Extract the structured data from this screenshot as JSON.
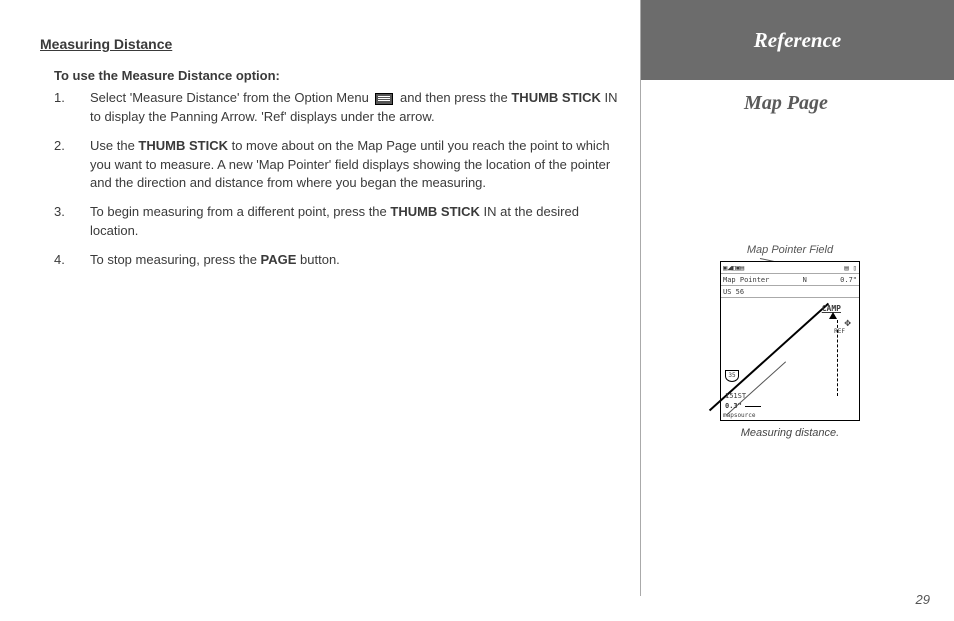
{
  "section_title": "Measuring Distance",
  "sub_title": "To use the Measure Distance option:",
  "steps": [
    {
      "num": "1.",
      "before": "Select 'Measure Distance' from the Option Menu ",
      "bold": "THUMB STICK",
      "mid": " and then press the ",
      "after": " IN to display the Panning Arrow.  'Ref' displays under the arrow."
    },
    {
      "num": "2.",
      "before": "Use the ",
      "bold": "THUMB STICK",
      "after": " to move about on the Map Page until you reach the point to which you want to measure.  A new 'Map Pointer' field displays showing the location of the pointer and the direction and distance from where you began the measuring."
    },
    {
      "num": "3.",
      "before": "To begin measuring from a different point, press the ",
      "bold": "THUMB STICK",
      "after": " IN at the desired location."
    },
    {
      "num": "4.",
      "before": "To stop measuring, press the ",
      "bold": "PAGE",
      "after": " button."
    }
  ],
  "ref_header": "Reference",
  "map_title": "Map Page",
  "fig_label": "Map Pointer Field",
  "screen": {
    "top_left": "▣◢◧▣▤",
    "top_right": "▤ ▯",
    "mp_label": "Map Pointer",
    "mp_n": "N",
    "mp_dist": "0.7\"",
    "us": "US 56",
    "camp": "CAMP",
    "ref": "REF",
    "shield": "35",
    "street": "151ST",
    "scale": "0.3\"",
    "mapsource": "mapsource"
  },
  "fig_caption": "Measuring distance.",
  "page_num": "29"
}
